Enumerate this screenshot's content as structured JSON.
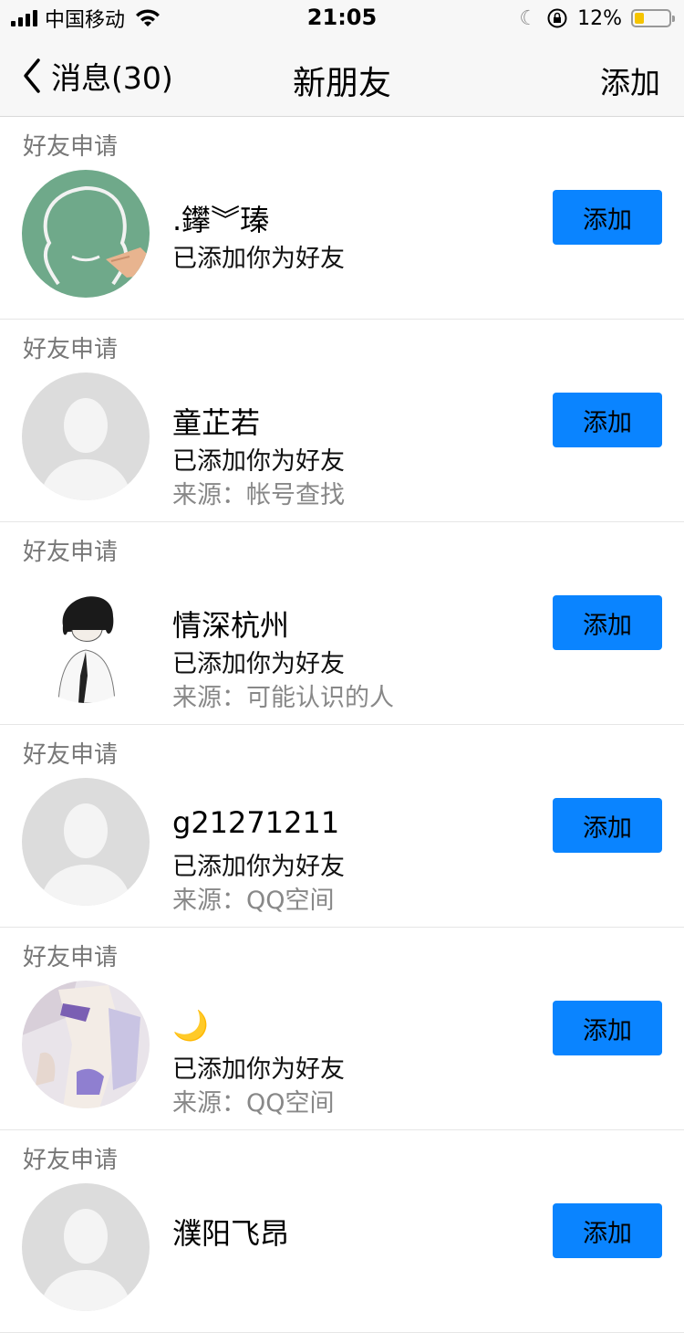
{
  "status_bar": {
    "carrier": "中国移动",
    "time": "21:05",
    "battery_percent": "12%",
    "battery_level": 0.12,
    "icons": [
      "signal-icon",
      "wifi-icon",
      "moon-icon",
      "rotation-lock-icon",
      "battery-icon"
    ]
  },
  "nav": {
    "back_label": "消息(30)",
    "title": "新朋友",
    "add_label": "添加"
  },
  "requests": [
    {
      "section": "好友申请",
      "name": ".鑻︾瑧",
      "status": "已添加你为好友",
      "source": "",
      "button": "添加",
      "avatar": "chalkboard-avatar"
    },
    {
      "section": "好友申请",
      "name": "童芷若",
      "status": "已添加你为好友",
      "source": "来源：帐号查找",
      "button": "添加",
      "avatar": "default-avatar"
    },
    {
      "section": "好友申请",
      "name": "情深杭州",
      "status": "已添加你为好友",
      "source": "来源：可能认识的人",
      "button": "添加",
      "avatar": "sketch-avatar"
    },
    {
      "section": "好友申请",
      "name": "g21271211",
      "status": "已添加你为好友",
      "source": "来源：QQ空间",
      "button": "添加",
      "avatar": "default-avatar"
    },
    {
      "section": "好友申请",
      "name": "🌙",
      "status": "已添加你为好友",
      "source": "来源：QQ空间",
      "button": "添加",
      "avatar": "photo-avatar"
    },
    {
      "section": "好友申请",
      "name": "濮阳飞昂",
      "status": "",
      "source": "",
      "button": "添加",
      "avatar": "default-avatar"
    }
  ]
}
